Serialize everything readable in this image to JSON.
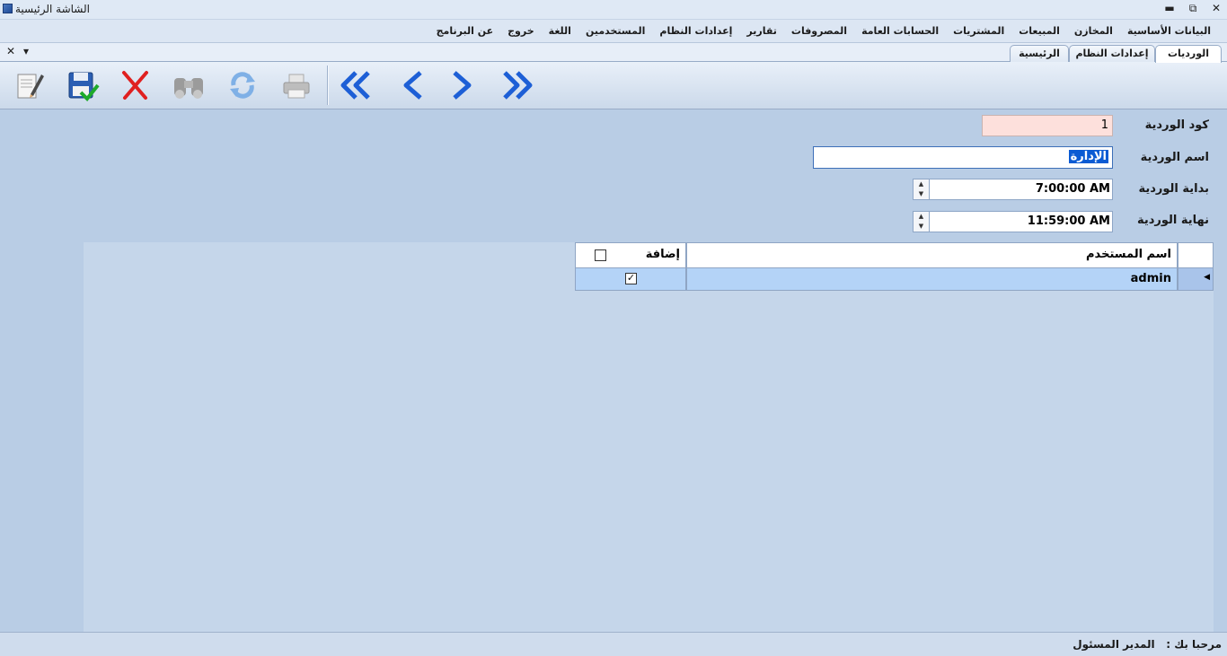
{
  "window": {
    "title": "الشاشة الرئيسية",
    "minimize_label": "▬",
    "restore_label": "⧉",
    "close_label": "✕"
  },
  "menu": {
    "items": [
      "البيانات الأساسية",
      "المخازن",
      "المبيعات",
      "المشتريات",
      "الحسابات العامة",
      "المصروفات",
      "تقارير",
      "إعدادات النظام",
      "المستخدمين",
      "اللغة",
      "خروج",
      "عن البرنامج"
    ]
  },
  "tabs": {
    "items": [
      "الورديات",
      "إعدادات النظام",
      "الرئيسية"
    ],
    "active": "الورديات",
    "close_label": "✕",
    "dropdown_label": "▾"
  },
  "toolbar": {
    "icons": [
      "edit-icon",
      "save-icon",
      "delete-icon",
      "search-binoculars-icon",
      "refresh-icon",
      "print-icon",
      "first-record-icon",
      "previous-record-icon",
      "next-record-icon",
      "last-record-icon"
    ]
  },
  "form": {
    "code_label": "كود الوردية",
    "code_value": "1",
    "name_label": "اسم الوردية",
    "name_value": "الإدارة",
    "start_label": "بداية الوردية",
    "start_value": "7:00:00 AM",
    "end_label": "نهاية الوردية",
    "end_value": "11:59:00 AM"
  },
  "grid": {
    "columns": [
      "اسم المستخدم",
      "إضافة"
    ],
    "header_checkbox_checked": false,
    "rows": [
      {
        "user": "admin",
        "add_checked": true
      }
    ]
  },
  "status": {
    "welcome_label": "مرحبا بك :",
    "user_name": "المدير المسئول"
  },
  "colors": {
    "background": "#b9cde5",
    "selection": "#0b5bd3",
    "code_field_bg": "#fde0dc",
    "row_highlight": "#b4d3f7"
  }
}
